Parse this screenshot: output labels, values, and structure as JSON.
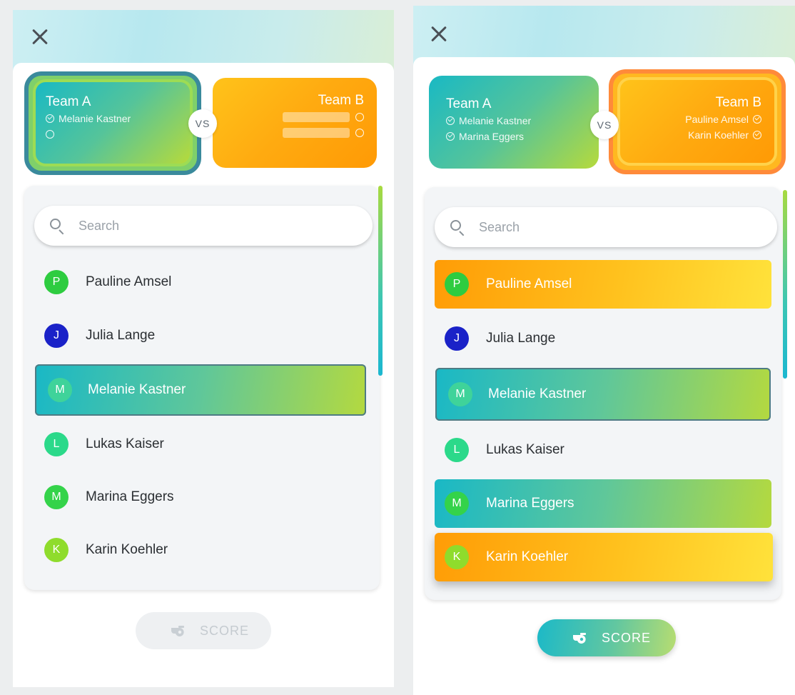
{
  "screens": [
    {
      "team_a": {
        "name": "Team A",
        "members": [
          "Melanie Kastner"
        ]
      },
      "team_b": {
        "name": "Team B",
        "members": []
      },
      "vs_label": "VS",
      "search_placeholder": "Search",
      "players": [
        {
          "initial": "P",
          "name": "Pauline Amsel",
          "avatar_color": "#2ecc40"
        },
        {
          "initial": "J",
          "name": "Julia Lange",
          "avatar_color": "#1a22c8"
        },
        {
          "initial": "M",
          "name": "Melanie Kastner",
          "avatar_color": "#3fd39a"
        },
        {
          "initial": "L",
          "name": "Lukas Kaiser",
          "avatar_color": "#2bd98a"
        },
        {
          "initial": "M",
          "name": "Marina Eggers",
          "avatar_color": "#34d34a"
        },
        {
          "initial": "K",
          "name": "Karin Koehler",
          "avatar_color": "#8fdc2c"
        }
      ],
      "score_label": "SCORE"
    },
    {
      "team_a": {
        "name": "Team A",
        "members": [
          "Melanie Kastner",
          "Marina Eggers"
        ]
      },
      "team_b": {
        "name": "Team B",
        "members": [
          "Pauline Amsel",
          "Karin Koehler"
        ]
      },
      "vs_label": "VS",
      "search_placeholder": "Search",
      "players": [
        {
          "initial": "P",
          "name": "Pauline Amsel",
          "avatar_color": "#2ecc40"
        },
        {
          "initial": "J",
          "name": "Julia Lange",
          "avatar_color": "#1a22c8"
        },
        {
          "initial": "M",
          "name": "Melanie Kastner",
          "avatar_color": "#3fd39a"
        },
        {
          "initial": "L",
          "name": "Lukas Kaiser",
          "avatar_color": "#2bd98a"
        },
        {
          "initial": "M",
          "name": "Marina Eggers",
          "avatar_color": "#34d34a"
        },
        {
          "initial": "K",
          "name": "Karin Koehler",
          "avatar_color": "#8fdc2c"
        }
      ],
      "score_label": "SCORE"
    }
  ],
  "colors": {
    "team_a_gradient": [
      "#19b9c4",
      "#b6da3b"
    ],
    "team_b_gradient": [
      "#ff9a05",
      "#ffe23b"
    ],
    "active_team_ring_a": "#3a8a9c",
    "active_team_ring_b": "#ff8a3a"
  },
  "icons": {
    "close": "close-icon",
    "search": "search-icon",
    "score": "whistle-icon",
    "member_check": "check-circle-icon",
    "member_empty": "empty-circle-icon"
  }
}
